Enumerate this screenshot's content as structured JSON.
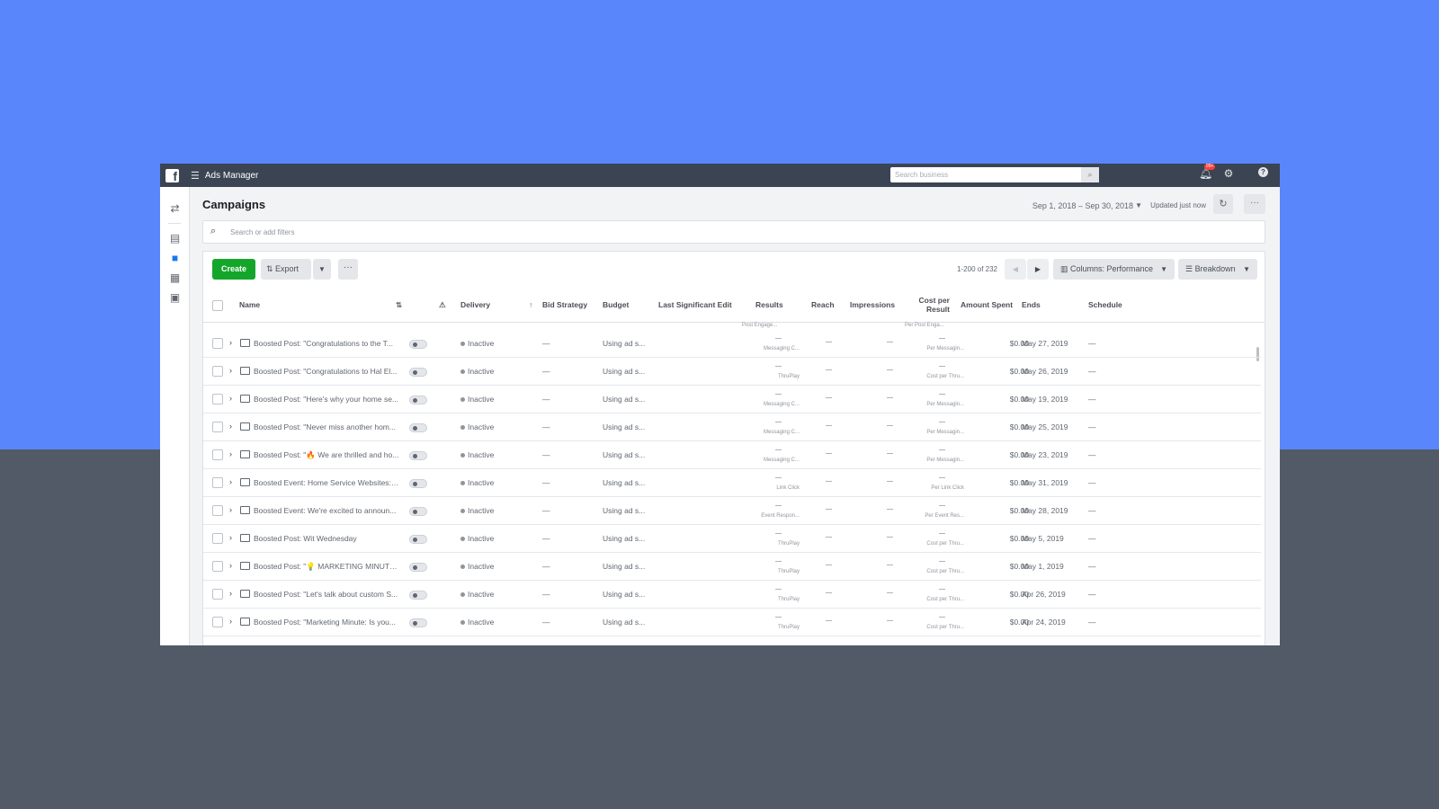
{
  "topbar": {
    "app_title": "Ads Manager",
    "search_placeholder": "Search business",
    "notification_badge": "99+"
  },
  "page": {
    "title": "Campaigns",
    "date_range": "Sep 1, 2018 – Sep 30, 2018",
    "updated": "Updated just now",
    "filter_placeholder": "Search or add filters"
  },
  "toolbar": {
    "create_label": "Create",
    "export_label": "Export",
    "pager": "1-200 of 232",
    "columns_label": "Columns: Performance",
    "breakdown_label": "Breakdown"
  },
  "table": {
    "headers": {
      "name": "Name",
      "delivery": "Delivery",
      "bid_strategy": "Bid Strategy",
      "budget": "Budget",
      "last_edit": "Last Significant Edit",
      "results": "Results",
      "reach": "Reach",
      "impressions": "Impressions",
      "cost_per_result_1": "Cost per",
      "cost_per_result_2": "Result",
      "amount_spent": "Amount Spent",
      "ends": "Ends",
      "schedule": "Schedule"
    },
    "partial_row": {
      "results_sub": "Post Engage...",
      "cost_sub": "Per Post Enga..."
    },
    "rows": [
      {
        "name": "Boosted Post: \"Congratulations to the T...",
        "delivery": "Inactive",
        "bid": "—",
        "budget": "Using ad s...",
        "results": "—",
        "results_sub": "Messaging C...",
        "reach": "—",
        "impressions": "—",
        "cost": "—",
        "cost_sub": "Per Messagin...",
        "spent": "$0.00",
        "ends": "May 27, 2019",
        "schedule": "—"
      },
      {
        "name": "Boosted Post: \"Congratulations to Hal El...",
        "delivery": "Inactive",
        "bid": "—",
        "budget": "Using ad s...",
        "results": "—",
        "results_sub": "ThruPlay",
        "reach": "—",
        "impressions": "—",
        "cost": "—",
        "cost_sub": "Cost per Thru...",
        "spent": "$0.00",
        "ends": "May 26, 2019",
        "schedule": "—"
      },
      {
        "name": "Boosted Post: \"Here's why your home se...",
        "delivery": "Inactive",
        "bid": "—",
        "budget": "Using ad s...",
        "results": "—",
        "results_sub": "Messaging C...",
        "reach": "—",
        "impressions": "—",
        "cost": "—",
        "cost_sub": "Per Messagin...",
        "spent": "$0.00",
        "ends": "May 19, 2019",
        "schedule": "—"
      },
      {
        "name": "Boosted Post: \"Never miss another hom...",
        "delivery": "Inactive",
        "bid": "—",
        "budget": "Using ad s...",
        "results": "—",
        "results_sub": "Messaging C...",
        "reach": "—",
        "impressions": "—",
        "cost": "—",
        "cost_sub": "Per Messagin...",
        "spent": "$0.00",
        "ends": "May 25, 2019",
        "schedule": "—"
      },
      {
        "name": "Boosted Post: \"🔥 We are thrilled and ho...",
        "delivery": "Inactive",
        "bid": "—",
        "budget": "Using ad s...",
        "results": "—",
        "results_sub": "Messaging C...",
        "reach": "—",
        "impressions": "—",
        "cost": "—",
        "cost_sub": "Per Messagin...",
        "spent": "$0.00",
        "ends": "May 23, 2019",
        "schedule": "—"
      },
      {
        "name": "Boosted Event: Home Service Websites: ...",
        "delivery": "Inactive",
        "bid": "—",
        "budget": "Using ad s...",
        "results": "—",
        "results_sub": "Link Click",
        "reach": "—",
        "impressions": "—",
        "cost": "—",
        "cost_sub": "Per Link Click",
        "spent": "$0.00",
        "ends": "May 31, 2019",
        "schedule": "—"
      },
      {
        "name": "Boosted Event: We're excited to announ...",
        "delivery": "Inactive",
        "bid": "—",
        "budget": "Using ad s...",
        "results": "—",
        "results_sub": "Event Respon...",
        "reach": "—",
        "impressions": "—",
        "cost": "—",
        "cost_sub": "Per Event Res...",
        "spent": "$0.00",
        "ends": "May 28, 2019",
        "schedule": "—"
      },
      {
        "name": "Boosted Post: Wit Wednesday",
        "delivery": "Inactive",
        "bid": "—",
        "budget": "Using ad s...",
        "results": "—",
        "results_sub": "ThruPlay",
        "reach": "—",
        "impressions": "—",
        "cost": "—",
        "cost_sub": "Cost per Thru...",
        "spent": "$0.00",
        "ends": "May 5, 2019",
        "schedule": "—"
      },
      {
        "name": "Boosted Post: \"💡 MARKETING MINUTE ...",
        "delivery": "Inactive",
        "bid": "—",
        "budget": "Using ad s...",
        "results": "—",
        "results_sub": "ThruPlay",
        "reach": "—",
        "impressions": "—",
        "cost": "—",
        "cost_sub": "Cost per Thru...",
        "spent": "$0.00",
        "ends": "May 1, 2019",
        "schedule": "—"
      },
      {
        "name": "Boosted Post: \"Let's talk about custom S...",
        "delivery": "Inactive",
        "bid": "—",
        "budget": "Using ad s...",
        "results": "—",
        "results_sub": "ThruPlay",
        "reach": "—",
        "impressions": "—",
        "cost": "—",
        "cost_sub": "Cost per Thru...",
        "spent": "$0.00",
        "ends": "Apr 26, 2019",
        "schedule": "—"
      },
      {
        "name": "Boosted Post: \"Marketing Minute: Is you...",
        "delivery": "Inactive",
        "bid": "—",
        "budget": "Using ad s...",
        "results": "—",
        "results_sub": "ThruPlay",
        "reach": "—",
        "impressions": "—",
        "cost": "—",
        "cost_sub": "Cost per Thru...",
        "spent": "$0.00",
        "ends": "Apr 24, 2019",
        "schedule": "—"
      }
    ]
  }
}
